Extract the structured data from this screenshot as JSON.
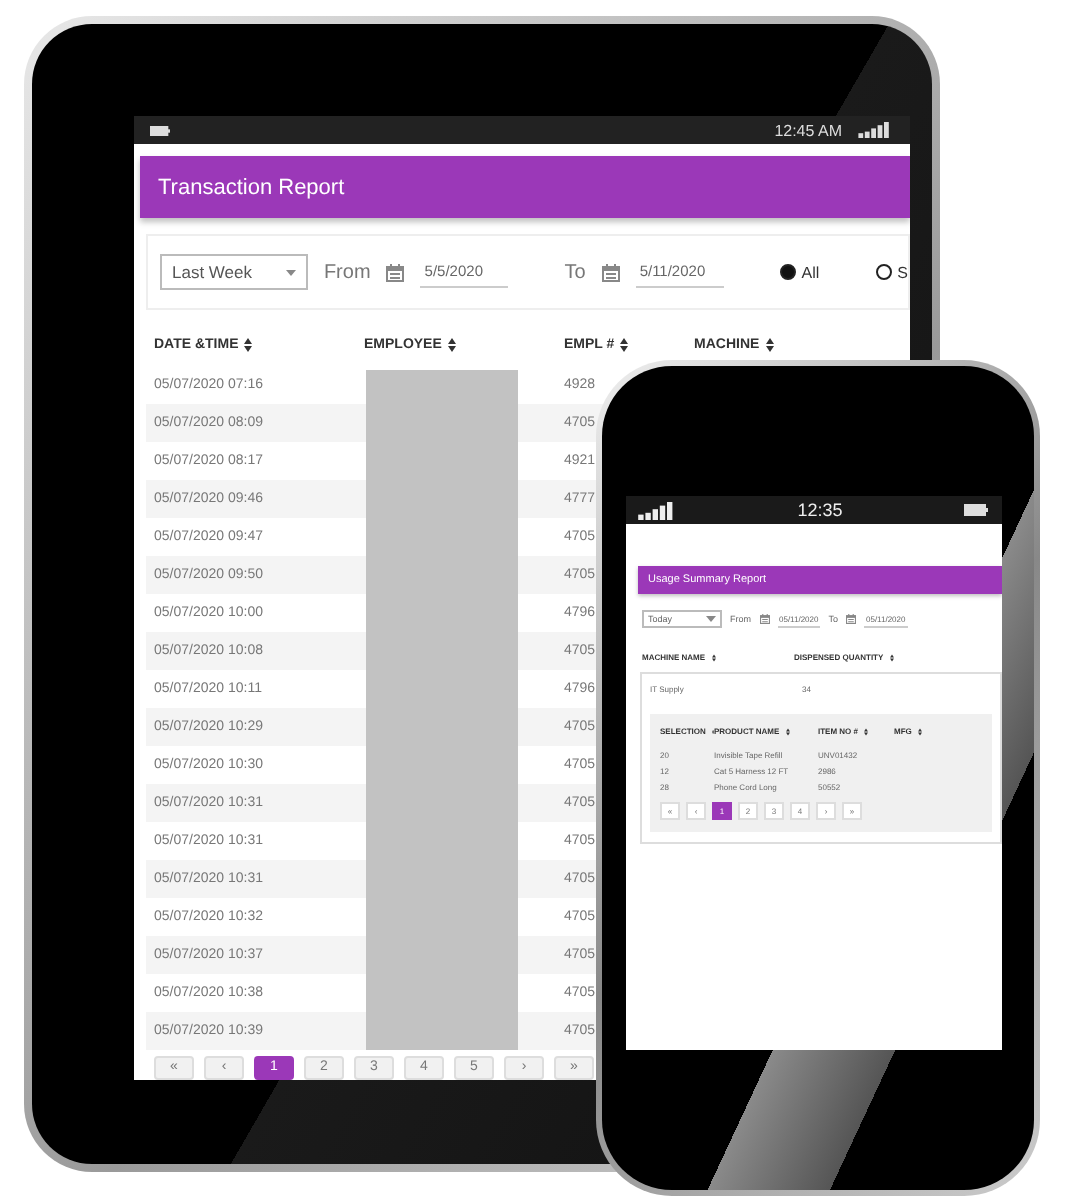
{
  "tablet": {
    "status_bar": {
      "time": "12:45 AM"
    },
    "title": "Transaction Report",
    "filters": {
      "period": "Last Week",
      "from_label": "From",
      "from_date": "5/5/2020",
      "to_label": "To",
      "to_date": "5/11/2020",
      "options": [
        {
          "label": "All",
          "selected": true
        },
        {
          "label": "S",
          "selected": false
        }
      ]
    },
    "table": {
      "columns": [
        "DATE &TIME",
        "EMPLOYEE",
        "EMPL #",
        "MACHINE"
      ],
      "rows": [
        {
          "date_time": "05/07/2020 07:16",
          "empl_no": "4928"
        },
        {
          "date_time": "05/07/2020 08:09",
          "empl_no": "4705"
        },
        {
          "date_time": "05/07/2020 08:17",
          "empl_no": "4921"
        },
        {
          "date_time": "05/07/2020 09:46",
          "empl_no": "4777"
        },
        {
          "date_time": "05/07/2020 09:47",
          "empl_no": "4705"
        },
        {
          "date_time": "05/07/2020 09:50",
          "empl_no": "4705"
        },
        {
          "date_time": "05/07/2020 10:00",
          "empl_no": "4796"
        },
        {
          "date_time": "05/07/2020 10:08",
          "empl_no": "4705"
        },
        {
          "date_time": "05/07/2020 10:11",
          "empl_no": "4796"
        },
        {
          "date_time": "05/07/2020 10:29",
          "empl_no": "4705"
        },
        {
          "date_time": "05/07/2020 10:30",
          "empl_no": "4705"
        },
        {
          "date_time": "05/07/2020 10:31",
          "empl_no": "4705"
        },
        {
          "date_time": "05/07/2020 10:31",
          "empl_no": "4705"
        },
        {
          "date_time": "05/07/2020 10:31",
          "empl_no": "4705"
        },
        {
          "date_time": "05/07/2020 10:32",
          "empl_no": "4705"
        },
        {
          "date_time": "05/07/2020 10:37",
          "empl_no": "4705"
        },
        {
          "date_time": "05/07/2020 10:38",
          "empl_no": "4705"
        },
        {
          "date_time": "05/07/2020 10:39",
          "empl_no": "4705"
        }
      ]
    },
    "pagination": [
      {
        "label": "«",
        "selected": false
      },
      {
        "label": "‹",
        "selected": false
      },
      {
        "label": "1",
        "selected": true
      },
      {
        "label": "2",
        "selected": false
      },
      {
        "label": "3",
        "selected": false
      },
      {
        "label": "4",
        "selected": false
      },
      {
        "label": "5",
        "selected": false
      },
      {
        "label": "›",
        "selected": false
      },
      {
        "label": "»",
        "selected": false
      }
    ]
  },
  "phone": {
    "status_bar": {
      "time": "12:35"
    },
    "title": "Usage Summary Report",
    "filters": {
      "period": "Today",
      "from_label": "From",
      "from_date": "05/11/2020",
      "to_label": "To",
      "to_date": "05/11/2020"
    },
    "table": {
      "columns": [
        "MACHINE NAME",
        "DISPENSED QUANTITY"
      ],
      "rows": [
        {
          "machine": "IT Supply",
          "quantity": "34"
        }
      ]
    },
    "detail": {
      "columns": [
        "SELECTION",
        "PRODUCT NAME",
        "ITEM NO #",
        "MFG"
      ],
      "rows": [
        [
          "20",
          "Invisible Tape Refill",
          "UNV01432"
        ],
        [
          "12",
          "Cat 5 Harness 12 FT",
          "2986"
        ],
        [
          "28",
          "Phone Cord Long",
          "50552"
        ]
      ]
    },
    "pagination": [
      {
        "label": "«",
        "selected": false
      },
      {
        "label": "‹",
        "selected": false
      },
      {
        "label": "1",
        "selected": true
      },
      {
        "label": "2",
        "selected": false
      },
      {
        "label": "3",
        "selected": false
      },
      {
        "label": "4",
        "selected": false
      },
      {
        "label": "›",
        "selected": false
      },
      {
        "label": "»",
        "selected": false
      }
    ]
  }
}
